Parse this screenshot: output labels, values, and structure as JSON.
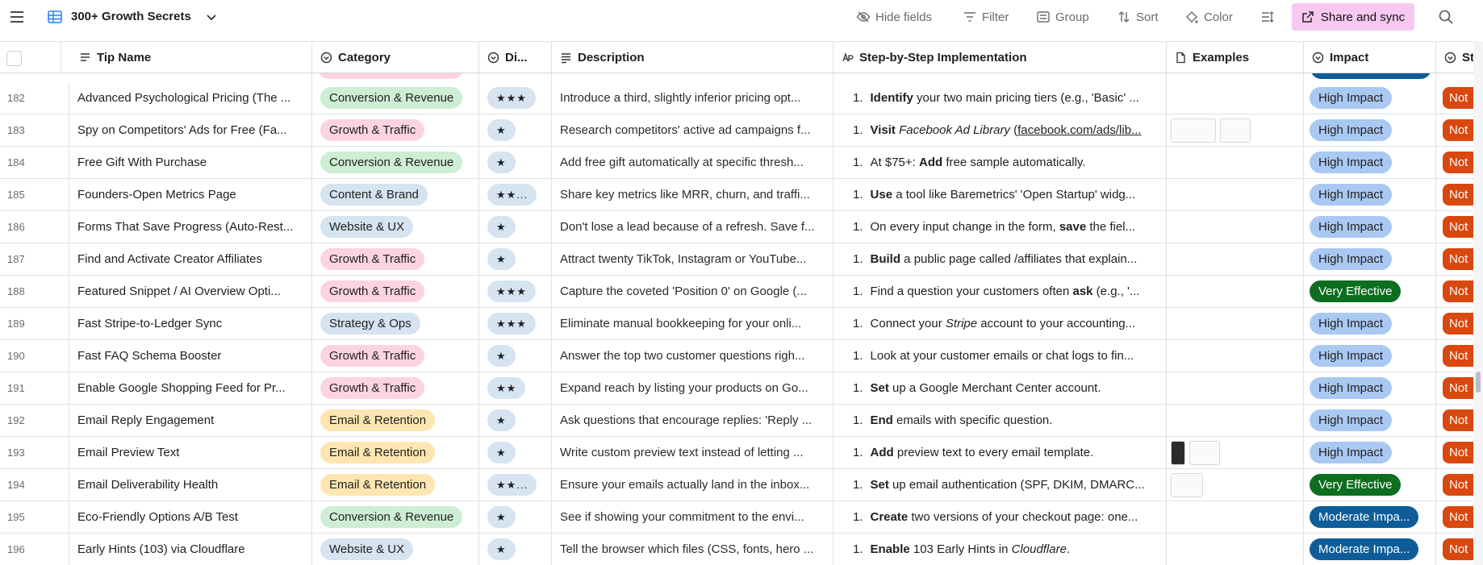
{
  "toolbar": {
    "title": "300+ Growth Secrets",
    "hide_fields": "Hide fields",
    "filter": "Filter",
    "group": "Group",
    "sort": "Sort",
    "color": "Color",
    "share": "Share and sync",
    "icons": [
      "menu-icon",
      "grid-icon",
      "chevron-down-icon",
      "eye-off-icon",
      "filter-icon",
      "group-icon",
      "sort-icon",
      "paint-icon",
      "row-height-icon",
      "share-icon",
      "search-icon"
    ]
  },
  "columns": {
    "tip_name": "Tip Name",
    "category": "Category",
    "difficulty": "Di...",
    "description": "Description",
    "steps": "Step-by-Step Implementation",
    "examples": "Examples",
    "impact": "Impact",
    "status": "St"
  },
  "colors": {
    "share_bg": "#f7c9f2",
    "high_impact": "#a9c8f2",
    "very_effective": "#0d6e1f",
    "moderate_impact": "#0d5d98",
    "status": "#d9480f",
    "conversion": "#cdeed3",
    "growth": "#fcd3e1",
    "email": "#fde6b1",
    "blue_tag": "#d6e3f0"
  },
  "rows": [
    {
      "num": "182",
      "name": "Advanced Psychological Pricing (The ...",
      "category": "Conversion & Revenue",
      "cat": "conv",
      "diff": "★★★",
      "desc": "Introduce a third, slightly inferior pricing opt...",
      "step": [
        [
          "num",
          "1."
        ],
        [
          "b",
          "Identify"
        ],
        [
          "t",
          " your two main pricing tiers (e.g., 'Basic' ..."
        ]
      ],
      "thumbs": 0,
      "impact": "High Impact",
      "imp": "high",
      "status": "Not"
    },
    {
      "num": "183",
      "name": "Spy on Competitors' Ads for Free (Fa...",
      "category": "Growth & Traffic",
      "cat": "growth",
      "diff": "★",
      "desc": "Research competitors' active ad campaigns f...",
      "step": [
        [
          "num",
          "1."
        ],
        [
          "b",
          "Visit"
        ],
        [
          "t",
          " "
        ],
        [
          "i",
          "Facebook Ad Library"
        ],
        [
          "t",
          " ("
        ],
        [
          "u",
          "facebook.com/ads/lib..."
        ]
      ],
      "thumbs": 2,
      "impact": "High Impact",
      "imp": "high",
      "status": "Not"
    },
    {
      "num": "184",
      "name": "Free Gift With Purchase",
      "category": "Conversion & Revenue",
      "cat": "conv",
      "diff": "★",
      "desc": "Add free gift automatically at specific thresh...",
      "step": [
        [
          "num",
          "1."
        ],
        [
          "t",
          "At $75+: "
        ],
        [
          "b",
          "Add"
        ],
        [
          "t",
          " free sample automatically."
        ]
      ],
      "thumbs": 0,
      "impact": "High Impact",
      "imp": "high",
      "status": "Not"
    },
    {
      "num": "185",
      "name": "Founders-Open Metrics Page",
      "category": "Content & Brand",
      "cat": "content",
      "diff": "★★...",
      "desc": "Share key metrics like MRR, churn, and traffi...",
      "step": [
        [
          "num",
          "1."
        ],
        [
          "b",
          "Use"
        ],
        [
          "t",
          " a tool like Baremetrics' 'Open Startup' widg..."
        ]
      ],
      "thumbs": 0,
      "impact": "High Impact",
      "imp": "high",
      "status": "Not"
    },
    {
      "num": "186",
      "name": "Forms That Save Progress (Auto-Rest...",
      "category": "Website & UX",
      "cat": "web",
      "diff": "★",
      "desc": "Don't lose a lead because of a refresh. Save f...",
      "step": [
        [
          "num",
          "1."
        ],
        [
          "t",
          "On every input change in the form, "
        ],
        [
          "b",
          "save"
        ],
        [
          "t",
          " the fiel..."
        ]
      ],
      "thumbs": 0,
      "impact": "High Impact",
      "imp": "high",
      "status": "Not"
    },
    {
      "num": "187",
      "name": "Find and Activate Creator Affiliates",
      "category": "Growth & Traffic",
      "cat": "growth",
      "diff": "★",
      "desc": "Attract twenty TikTok, Instagram or YouTube...",
      "step": [
        [
          "num",
          "1."
        ],
        [
          "b",
          "Build"
        ],
        [
          "t",
          " a public page called /affiliates that explain..."
        ]
      ],
      "thumbs": 0,
      "impact": "High Impact",
      "imp": "high",
      "status": "Not"
    },
    {
      "num": "188",
      "name": "Featured Snippet / AI Overview Opti...",
      "category": "Growth & Traffic",
      "cat": "growth",
      "diff": "★★★",
      "desc": "Capture the coveted 'Position 0' on Google (...",
      "step": [
        [
          "num",
          "1."
        ],
        [
          "t",
          "Find a question your customers often "
        ],
        [
          "b",
          "ask"
        ],
        [
          "t",
          " (e.g., '..."
        ]
      ],
      "thumbs": 0,
      "impact": "Very Effective",
      "imp": "very",
      "status": "Not"
    },
    {
      "num": "189",
      "name": "Fast Stripe-to-Ledger Sync",
      "category": "Strategy & Ops",
      "cat": "strat",
      "diff": "★★★",
      "desc": "Eliminate manual bookkeeping for your onli...",
      "step": [
        [
          "num",
          "1."
        ],
        [
          "t",
          "Connect your "
        ],
        [
          "i",
          "Stripe"
        ],
        [
          "t",
          " account to your accounting..."
        ]
      ],
      "thumbs": 0,
      "impact": "High Impact",
      "imp": "high",
      "status": "Not"
    },
    {
      "num": "190",
      "name": "Fast FAQ Schema Booster",
      "category": "Growth & Traffic",
      "cat": "growth",
      "diff": "★",
      "desc": "Answer the top two customer questions righ...",
      "step": [
        [
          "num",
          "1."
        ],
        [
          "t",
          "Look at your customer emails or chat logs to fin..."
        ]
      ],
      "thumbs": 0,
      "impact": "High Impact",
      "imp": "high",
      "status": "Not"
    },
    {
      "num": "191",
      "name": "Enable Google Shopping Feed for Pr...",
      "category": "Growth & Traffic",
      "cat": "growth",
      "diff": "★★",
      "desc": "Expand reach by listing your products on Go...",
      "step": [
        [
          "num",
          "1."
        ],
        [
          "b",
          "Set"
        ],
        [
          "t",
          " up a Google Merchant Center account."
        ]
      ],
      "thumbs": 0,
      "impact": "High Impact",
      "imp": "high",
      "status": "Not"
    },
    {
      "num": "192",
      "name": "Email Reply Engagement",
      "category": "Email & Retention",
      "cat": "email",
      "diff": "★",
      "desc": "Ask questions that encourage replies: 'Reply ...",
      "step": [
        [
          "num",
          "1."
        ],
        [
          "b",
          "End"
        ],
        [
          "t",
          " emails with specific question."
        ]
      ],
      "thumbs": 0,
      "impact": "High Impact",
      "imp": "high",
      "status": "Not"
    },
    {
      "num": "193",
      "name": "Email Preview Text",
      "category": "Email & Retention",
      "cat": "email",
      "diff": "★",
      "desc": "Write custom preview text instead of letting ...",
      "step": [
        [
          "num",
          "1."
        ],
        [
          "b",
          "Add"
        ],
        [
          "t",
          " preview text to every email template."
        ]
      ],
      "thumbs": 2,
      "impact": "High Impact",
      "imp": "high",
      "status": "Not"
    },
    {
      "num": "194",
      "name": "Email Deliverability Health",
      "category": "Email & Retention",
      "cat": "email",
      "diff": "★★...",
      "desc": "Ensure your emails actually land in the inbox...",
      "step": [
        [
          "num",
          "1."
        ],
        [
          "b",
          "Set"
        ],
        [
          "t",
          " up email authentication (SPF, DKIM, DMARC..."
        ]
      ],
      "thumbs": 1,
      "impact": "Very Effective",
      "imp": "very",
      "status": "Not"
    },
    {
      "num": "195",
      "name": "Eco-Friendly Options A/B Test",
      "category": "Conversion & Revenue",
      "cat": "conv",
      "diff": "★",
      "desc": "See if showing your commitment to the envi...",
      "step": [
        [
          "num",
          "1."
        ],
        [
          "b",
          "Create"
        ],
        [
          "t",
          " two versions of your checkout page: one..."
        ]
      ],
      "thumbs": 0,
      "impact": "Moderate Impa...",
      "imp": "mod",
      "status": "Not"
    },
    {
      "num": "196",
      "name": "Early Hints (103) via Cloudflare",
      "category": "Website & UX",
      "cat": "web",
      "diff": "★",
      "desc": "Tell the browser which files (CSS, fonts, hero ...",
      "step": [
        [
          "num",
          "1."
        ],
        [
          "b",
          "Enable"
        ],
        [
          "t",
          " 103 Early Hints in "
        ],
        [
          "i",
          "Cloudflare"
        ],
        [
          "t",
          "."
        ]
      ],
      "thumbs": 0,
      "impact": "Moderate Impa...",
      "imp": "mod",
      "status": "Not"
    }
  ]
}
